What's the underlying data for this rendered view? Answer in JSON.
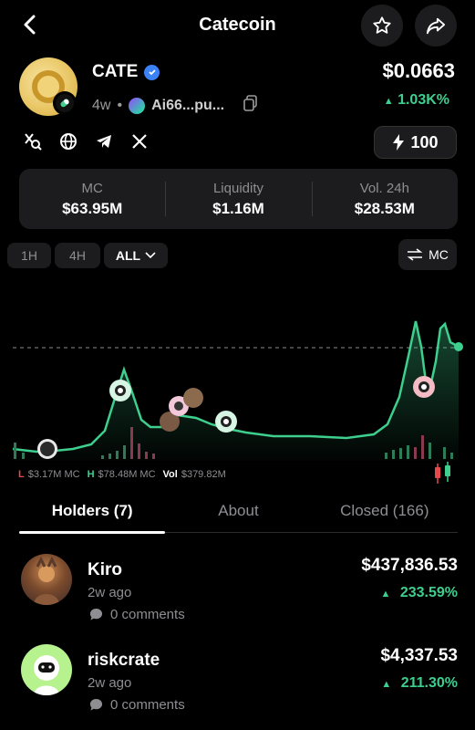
{
  "header": {
    "title": "Catecoin",
    "back_icon": "chevron-left-icon",
    "favorite_icon": "star-icon",
    "share_icon": "share-icon"
  },
  "token": {
    "symbol": "CATE",
    "age": "4w",
    "address": "Ai66...pu...",
    "price": "$0.0663",
    "change": "1.03K%",
    "change_color": "#3ecf8e"
  },
  "social": {
    "icons": [
      "x-search-icon",
      "globe-icon",
      "telegram-icon",
      "x-icon"
    ]
  },
  "boost": {
    "value": "100"
  },
  "stats": [
    {
      "label": "MC",
      "value": "$63.95M"
    },
    {
      "label": "Liquidity",
      "value": "$1.16M"
    },
    {
      "label": "Vol. 24h",
      "value": "$28.53M"
    }
  ],
  "timeframes": [
    {
      "label": "1H"
    },
    {
      "label": "4H"
    },
    {
      "label": "ALL"
    }
  ],
  "selected_timeframe": "ALL",
  "mc_toggle": {
    "label": "MC"
  },
  "chart_legend": {
    "low_label": "L",
    "low_value": "$3.17M MC",
    "high_label": "H",
    "high_value": "$78.48M MC",
    "vol_label": "Vol",
    "vol_value": "$379.82M"
  },
  "tabs": [
    {
      "label": "Holders (7)"
    },
    {
      "label": "About"
    },
    {
      "label": "Closed (166)"
    }
  ],
  "holders": [
    {
      "name": "Kiro",
      "ago": "2w ago",
      "comments": "0 comments",
      "value": "$437,836.53",
      "change": "233.59%"
    },
    {
      "name": "riskcrate",
      "ago": "2w ago",
      "comments": "0 comments",
      "value": "$4,337.53",
      "change": "211.30%"
    }
  ],
  "colors": {
    "accent_green": "#3ecf8e",
    "accent_red": "#e5484d",
    "surface": "#1c1c1e"
  }
}
